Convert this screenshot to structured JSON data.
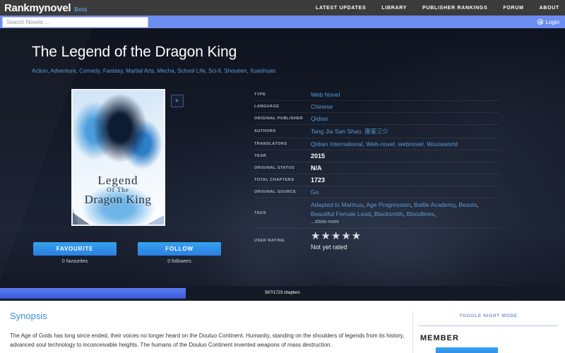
{
  "header": {
    "brand": "Rankmynovel",
    "beta": "Beta",
    "nav": [
      {
        "label": "LATEST UPDATES"
      },
      {
        "label": "LIBRARY"
      },
      {
        "label": "PUBLISHER RANKINGS"
      },
      {
        "label": "FORUM"
      },
      {
        "label": "ABOUT"
      }
    ],
    "search_placeholder": "Search Novels ...",
    "search_value": "",
    "login_label": "Login"
  },
  "novel": {
    "title": "The Legend of the Dragon King",
    "genres": [
      "Action",
      "Adventure",
      "Comedy",
      "Fantasy",
      "Martial Arts",
      "Mecha",
      "School Life",
      "Sci-fi",
      "Shounen",
      "Xuanhuan"
    ],
    "cover": {
      "line1": "Legend",
      "line2": "Of The",
      "line3": "Dragon King"
    },
    "add_button": "+",
    "favourite_label": "FAVOURITE",
    "favourite_count": "0 favourites",
    "follow_label": "FOLLOW",
    "follow_count": "0 followers"
  },
  "info": {
    "rows": [
      {
        "label": "TYPE",
        "value": "Web Novel",
        "link": true
      },
      {
        "label": "LANGUAGE",
        "value": "Chinese",
        "link": true
      },
      {
        "label": "ORIGINAL PUBLISHER",
        "value": "Qidian",
        "link": true
      },
      {
        "label": "AUTHORS",
        "value": "Tang Jia San Shao, 唐家三少",
        "link": true
      },
      {
        "label": "TRANSLATORS",
        "value": "Qidian International, Web-novel, webnovel, Wuxiaworld",
        "link": true
      },
      {
        "label": "YEAR",
        "value": "2015",
        "link": false
      },
      {
        "label": "ORIGINAL STATUS",
        "value": "N/A",
        "link": false
      },
      {
        "label": "TOTAL CHAPTERS",
        "value": "1723",
        "link": false
      },
      {
        "label": "ORIGINAL SOURCE",
        "value": "Go",
        "link": true
      }
    ],
    "tags_label": "TAGS",
    "tags": [
      "Adapted to Manhua",
      "Age Progression",
      "Battle Academy",
      "Beasts",
      "Beautiful Female Lead",
      "Blacksmith",
      "Bloodlines"
    ],
    "show_more": "...show more",
    "rating_label": "USER RATING",
    "stars": "★★★★★",
    "stars_count": 5,
    "rating_text": "Not yet rated"
  },
  "progress": {
    "label": "567/1723 chapters",
    "read": 567,
    "total": 1723
  },
  "synopsis": {
    "title": "Synopsis",
    "body": "The Age of Gods has long since ended, their voices no longer heard on the Douluo Continent. Humanity, standing on the shoulders of legends from its history, advanced soul technology to inconceivable heights. The humans of the Douluo Continent invented weapons of mass destruction."
  },
  "sidebar": {
    "night_mode": "TOGGLE NIGHT MODE",
    "member_title": "MEMBER"
  },
  "colors": {
    "accent_blue": "#5b9bd5",
    "button_blue": "#2f8fe8",
    "search_bar": "#6b8df0",
    "topbar": "#3b3b3b",
    "hero_dark": "#141926",
    "progress_fill": "#3a58d8"
  }
}
